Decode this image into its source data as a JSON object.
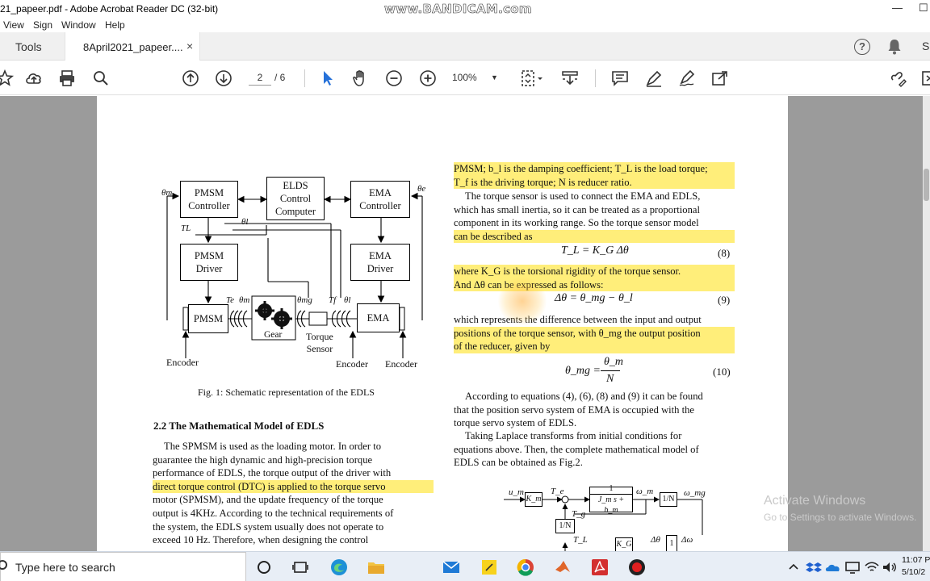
{
  "window": {
    "title": "21_papeer.pdf - Adobe Acrobat Reader DC (32-bit)",
    "watermark": "www.BANDICAM.com",
    "minimize": "—",
    "maximize": "☐"
  },
  "menu": {
    "items": [
      "View",
      "Sign",
      "Window",
      "Help"
    ]
  },
  "tabs": {
    "tools": "Tools",
    "document": "8April2021_papeer....",
    "close": "×",
    "signin": "S"
  },
  "toolbar": {
    "page_current": "2",
    "page_total": "/ 6",
    "zoom": "100%"
  },
  "page": {
    "right_col": {
      "p1": [
        "PMSM; b_l is the damping coefficient; T_L is the load torque;",
        "T_f is the driving torque; N is reducer ratio."
      ],
      "p2": [
        "The torque sensor is used to connect the EMA and EDLS,",
        "which has small inertia, so it can be treated as a proportional",
        "component in its working range. So the torque sensor model",
        "can be described as"
      ],
      "eq8": "T_L = K_G Δθ",
      "eq8_num": "(8)",
      "p3": [
        "where K_G is the torsional rigidity of the torque sensor.",
        "And Δθ can be expressed as follows:"
      ],
      "eq9": "Δθ = θ_mg − θ_l",
      "eq9_num": "(9)",
      "p4": [
        "which represents the difference between the input and output",
        "positions of the torque sensor, with θ_mg the output position",
        "of the reducer, given by"
      ],
      "eq10_lhs": "θ_mg =",
      "eq10_num_top": "θ_m",
      "eq10_den": "N",
      "eq10_num": "(10)",
      "p5": [
        "According to equations (4), (6), (8) and (9) it can be found",
        "that the position servo system of EMA is occupied with the",
        "torque servo system of EDLS."
      ],
      "p6": [
        "Taking Laplace transforms from initial conditions for",
        "equations above. Then, the complete mathematical model of",
        "EDLS can be obtained as Fig.2."
      ]
    },
    "left_col": {
      "caption": "Fig. 1: Schematic representation of the EDLS",
      "heading": "2.2   The Mathematical Model of EDLS",
      "p1": [
        "The SPMSM is used as the loading motor. In order to",
        "guarantee the high dynamic and high-precision torque",
        "performance of EDLS, the torque output of the driver with",
        "direct torque control (DTC) is applied to the torque servo",
        "motor (SPMSM), and the update frequency of the torque",
        "output is 4KHz. According to the technical requirements of",
        "the system, the EDLS system usually does not operate to",
        "exceed 10 Hz. Therefore, when designing the control"
      ]
    },
    "diagram": {
      "pmsm_controller": [
        "PMSM",
        "Controller"
      ],
      "elds_controller": [
        "ELDS",
        "Control",
        "Computer"
      ],
      "ema_controller": [
        "EMA",
        "Controller"
      ],
      "pmsm_driver": [
        "PMSM",
        "Driver"
      ],
      "ema_driver": [
        "EMA",
        "Driver"
      ],
      "pmsm": "PMSM",
      "gear": "Gear",
      "ema": "EMA",
      "torque_sensor": [
        "Torque",
        "Sensor"
      ],
      "encoder": "Encoder",
      "theta_m": "θm",
      "theta_e": "θe",
      "theta_l": "θl",
      "theta_mg": "θmg",
      "TL": "TL",
      "Te": "Te",
      "Tf": "Tf"
    },
    "fig2": {
      "um": "u_m",
      "Km": "K_m",
      "Te": "T_e",
      "block_num": "1",
      "block_den": "J_m s + b_m",
      "omega_m": "ω_m",
      "oneN": "1/N",
      "omega_mg": "ω_mg",
      "Tg": "T_g",
      "oneN2": "1/N",
      "TL": "T_L",
      "KG": "K_G",
      "dtheta": "Δθ",
      "one": "1",
      "domega": "Δω"
    }
  },
  "activate": {
    "line1": "Activate Windows",
    "line2": "Go to Settings to activate Windows."
  },
  "taskbar": {
    "search_placeholder": "Type here to search",
    "time": "11:07 P",
    "date": "5/10/2"
  }
}
